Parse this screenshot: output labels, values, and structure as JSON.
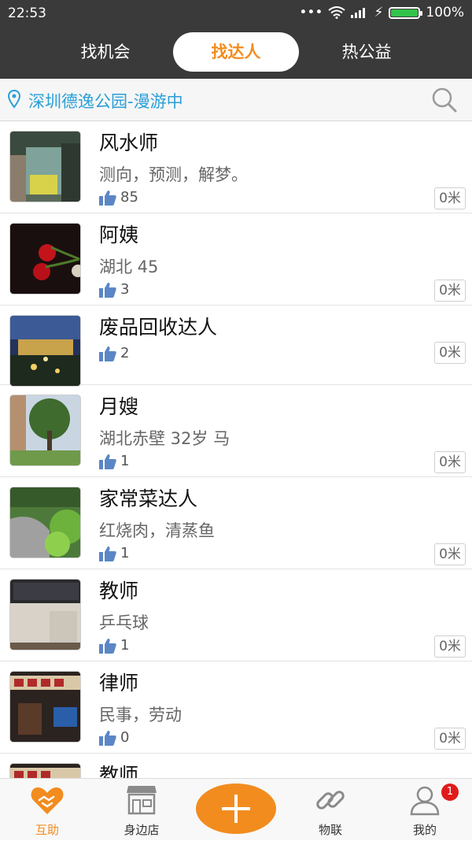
{
  "status": {
    "time": "22:53",
    "battery": "100%"
  },
  "tabs": [
    {
      "label": "找机会",
      "active": false
    },
    {
      "label": "找达人",
      "active": true
    },
    {
      "label": "热公益",
      "active": false
    }
  ],
  "location": {
    "text": "深圳德逸公园-漫游中"
  },
  "items": [
    {
      "title": "风水师",
      "desc": "测向，预测，解梦。",
      "likes": "85",
      "distance": "0米"
    },
    {
      "title": "阿姨",
      "desc": "湖北 45",
      "likes": "3",
      "distance": "0米"
    },
    {
      "title": "废品回收达人",
      "desc": "",
      "likes": "2",
      "distance": "0米"
    },
    {
      "title": "月嫂",
      "desc": "湖北赤壁 32岁 马",
      "likes": "1",
      "distance": "0米"
    },
    {
      "title": "家常菜达人",
      "desc": "红烧肉，清蒸鱼",
      "likes": "1",
      "distance": "0米"
    },
    {
      "title": "教师",
      "desc": "乒乓球",
      "likes": "1",
      "distance": "0米"
    },
    {
      "title": "律师",
      "desc": "民事，劳动",
      "likes": "0",
      "distance": "0米"
    },
    {
      "title": "教师",
      "desc": "",
      "likes": "",
      "distance": ""
    }
  ],
  "tabbar": [
    {
      "label": "互助",
      "icon": "handshake-heart-icon",
      "active": true
    },
    {
      "label": "身边店",
      "icon": "store-icon",
      "active": false
    },
    {
      "label": "",
      "icon": "plus-icon",
      "active": false
    },
    {
      "label": "物联",
      "icon": "link-icon",
      "active": false
    },
    {
      "label": "我的",
      "icon": "user-icon",
      "active": false
    }
  ],
  "badge": "1",
  "colors": {
    "accent": "#f28c1e",
    "header_bg": "#3a3a3a",
    "location_text": "#2a9fd8",
    "like_icon": "#5b86c5"
  }
}
